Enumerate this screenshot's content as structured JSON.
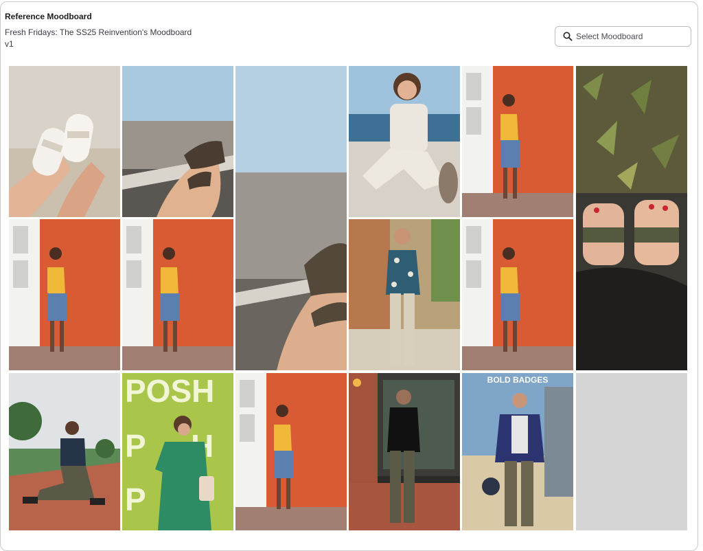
{
  "header": {
    "title": "Reference Moodboard",
    "subtitle": "Fresh Fridays: The SS25 Reinvention's Moodboard",
    "version": "v1"
  },
  "search": {
    "placeholder": "Select Moodboard",
    "icon": "search-icon"
  },
  "tiles": [
    {
      "name": "photo-sandals-on-sand"
    },
    {
      "name": "photo-feet-on-boat-deck"
    },
    {
      "name": "photo-sea-horizon-sandal"
    },
    {
      "name": "photo-woman-laughing-with-cat"
    },
    {
      "name": "photo-woman-orange-wall"
    },
    {
      "name": "photo-leaves-and-red-toenails"
    },
    {
      "name": "photo-woman-orange-wall"
    },
    {
      "name": "photo-woman-orange-wall"
    },
    {
      "name": "photo-man-floral-shirt"
    },
    {
      "name": "photo-woman-orange-wall"
    },
    {
      "name": "photo-man-crouching-track"
    },
    {
      "name": "photo-posh-green-dress",
      "text": "POSH"
    },
    {
      "name": "photo-woman-orange-wall"
    },
    {
      "name": "photo-man-black-tshirt"
    },
    {
      "name": "photo-man-bomber-jacket",
      "text": "BOLD BADGES"
    }
  ]
}
